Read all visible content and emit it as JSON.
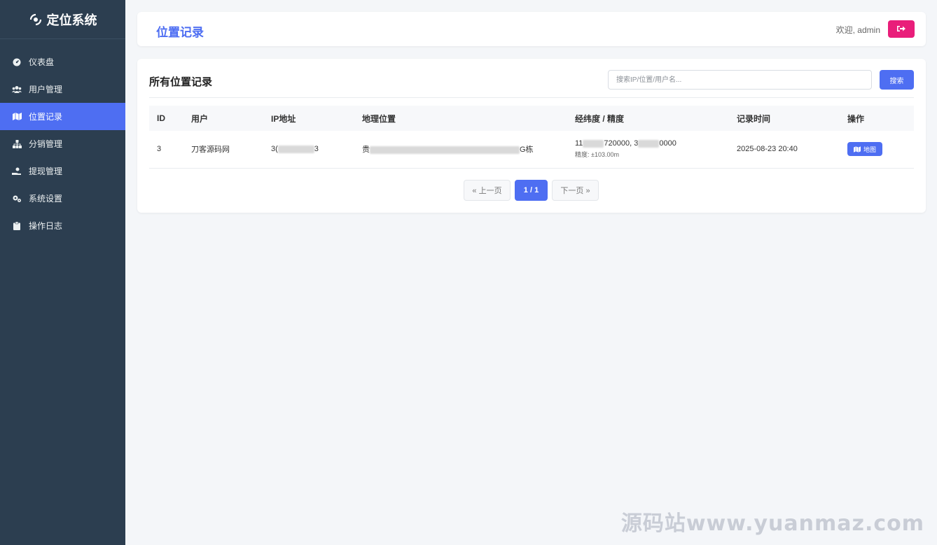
{
  "brand": {
    "title": "定位系统",
    "icon": "satellite-icon"
  },
  "sidebar": {
    "items": [
      {
        "label": "仪表盘",
        "icon": "dashboard-icon",
        "active": false
      },
      {
        "label": "用户管理",
        "icon": "users-icon",
        "active": false
      },
      {
        "label": "位置记录",
        "icon": "map-icon",
        "active": true
      },
      {
        "label": "分销管理",
        "icon": "sitemap-icon",
        "active": false
      },
      {
        "label": "提现管理",
        "icon": "hand-coin-icon",
        "active": false
      },
      {
        "label": "系统设置",
        "icon": "gears-icon",
        "active": false
      },
      {
        "label": "操作日志",
        "icon": "clipboard-icon",
        "active": false
      }
    ]
  },
  "header": {
    "title": "位置记录",
    "welcome": "欢迎, admin",
    "logout_icon": "logout-icon"
  },
  "main": {
    "card_title": "所有位置记录",
    "search": {
      "placeholder": "搜索IP/位置/用户名...",
      "value": "",
      "button": "搜索"
    },
    "table": {
      "columns": [
        "ID",
        "用户",
        "IP地址",
        "地理位置",
        "经纬度 / 精度",
        "记录时间",
        "操作"
      ],
      "rows": [
        {
          "id": "3",
          "user": "刀客源码网",
          "ip_start": "3(",
          "ip_end": "3",
          "location_start": "贵",
          "location_end": "G栋",
          "coords_a_start": "11",
          "coords_a_end": "720000, 3",
          "coords_b_end": "0000",
          "accuracy": "精度: ±103.00m",
          "time": "2025-08-23 20:40",
          "action": "地图"
        }
      ]
    },
    "pager": {
      "prev": "« 上一页",
      "current": "1 / 1",
      "next": "下一页 »"
    }
  },
  "watermark": "源码站www.yuanmaz.com",
  "colors": {
    "sidebar": "#2c3e50",
    "accent": "#4e6ef2",
    "logout": "#e91e7a"
  }
}
